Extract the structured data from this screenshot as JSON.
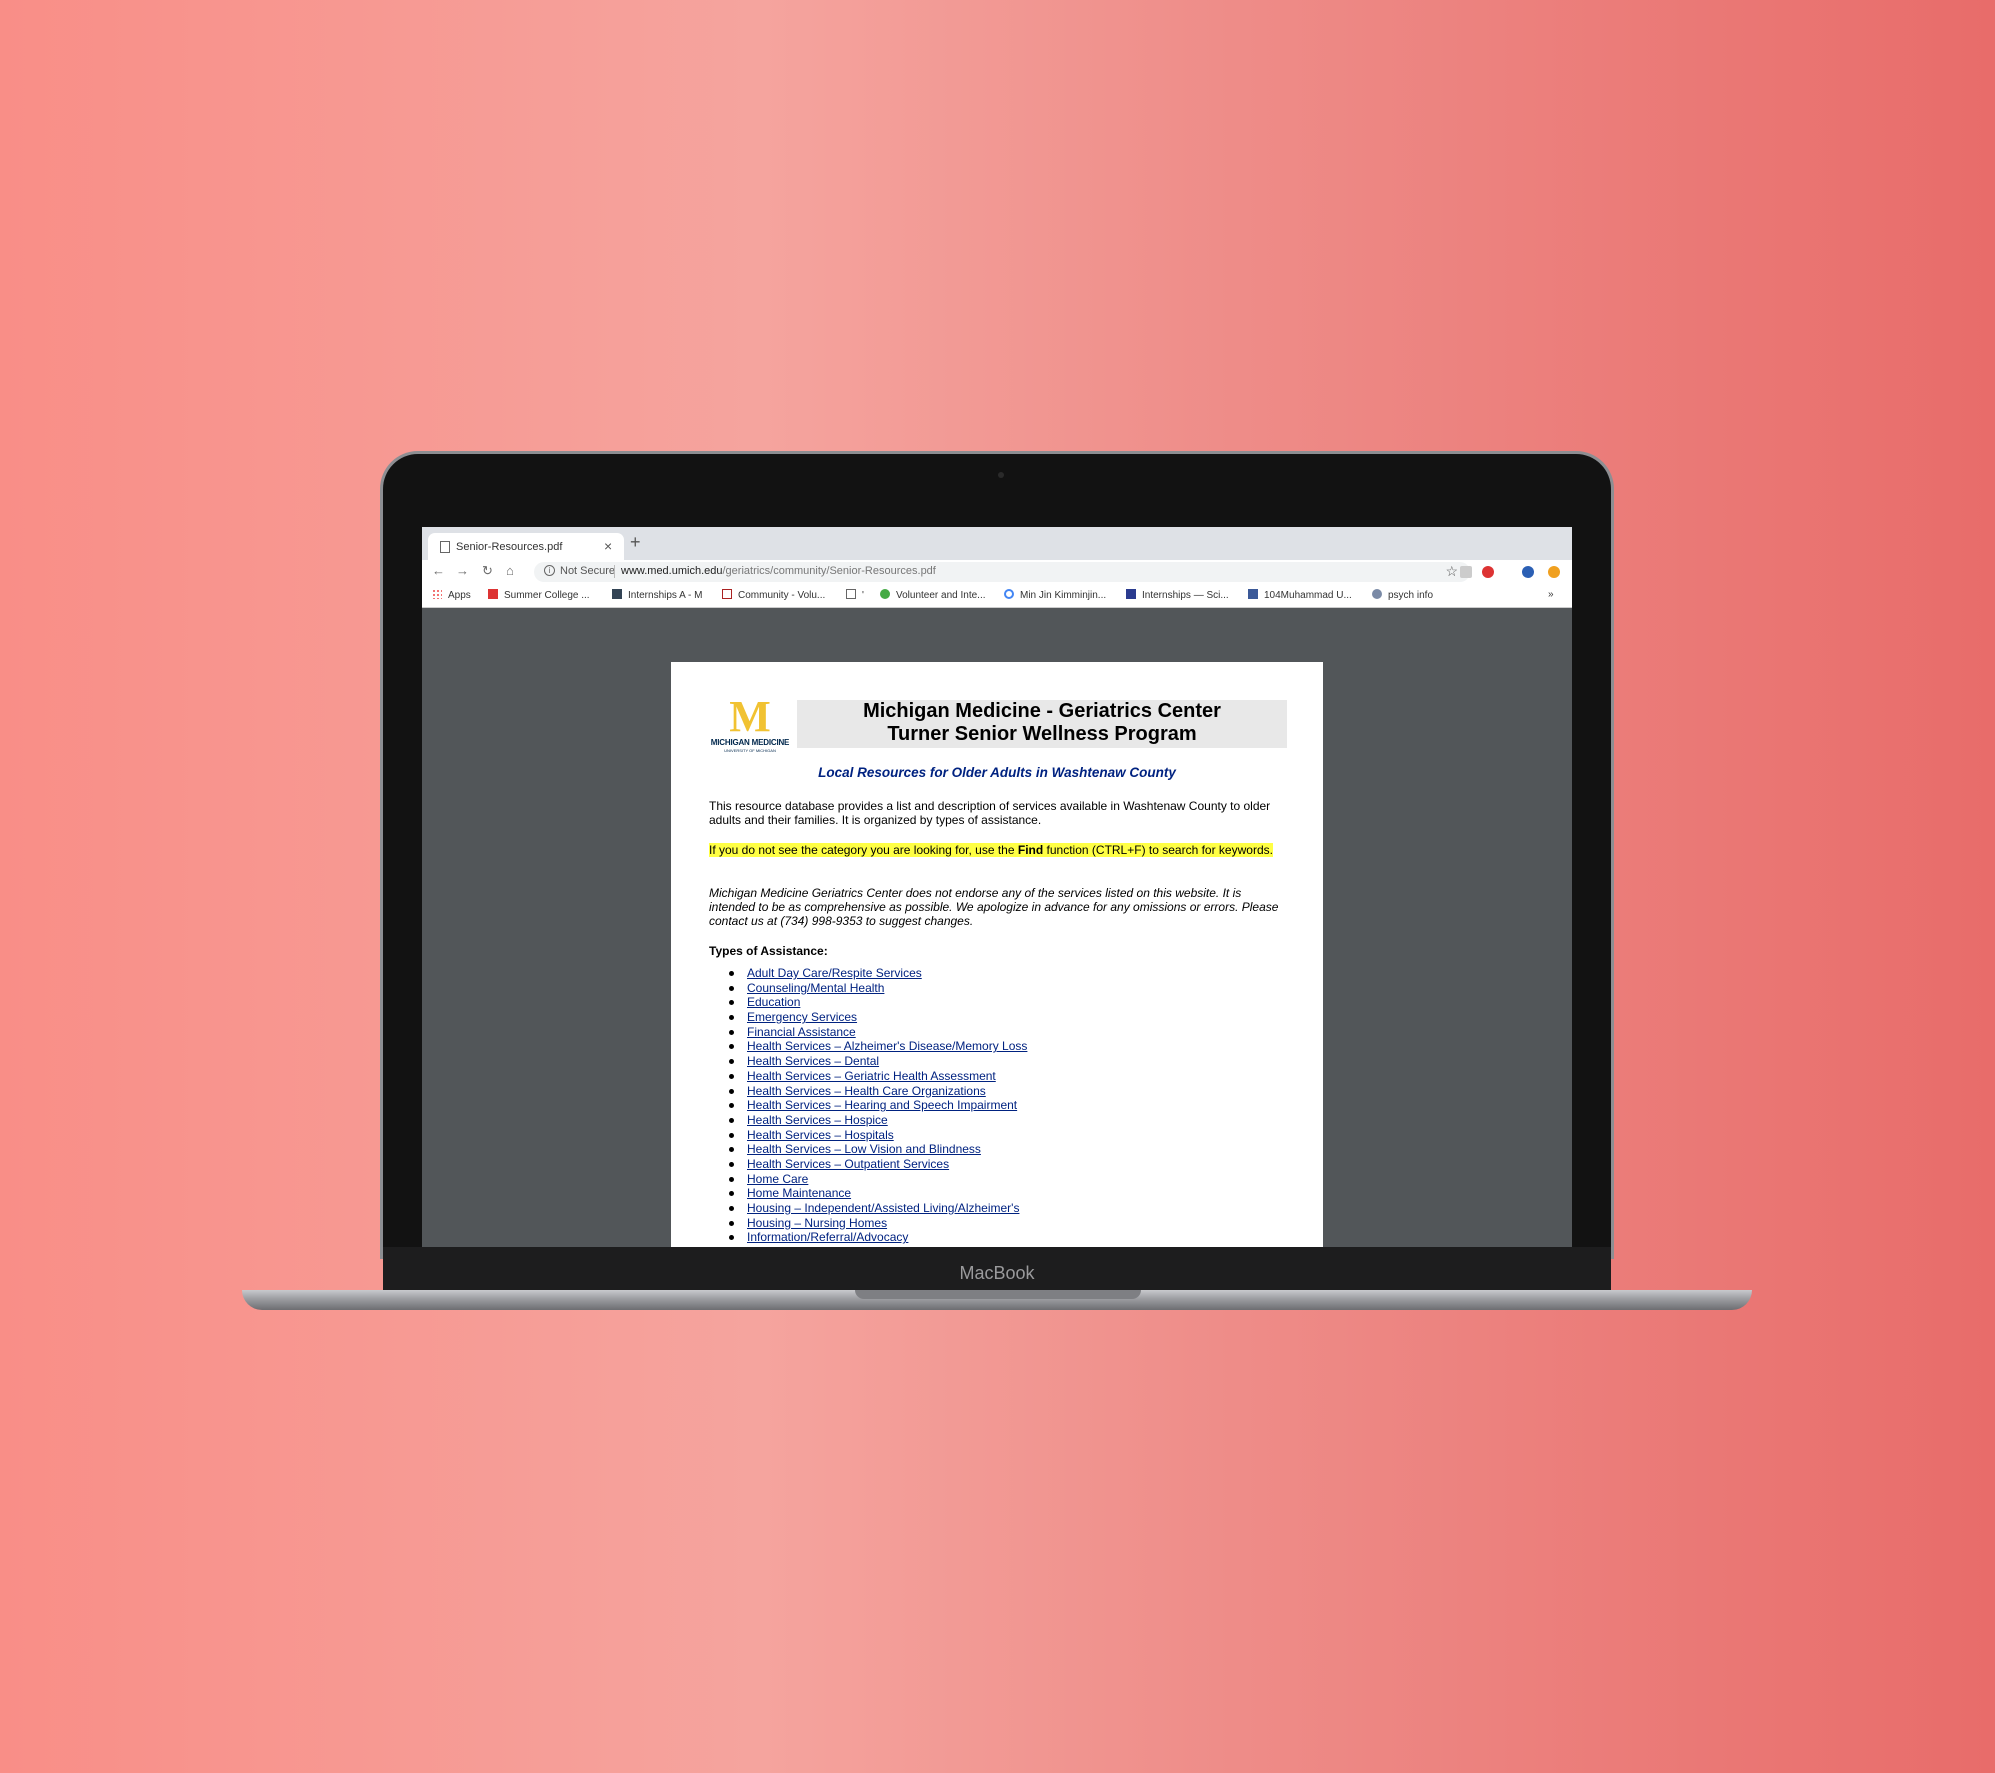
{
  "device": {
    "brand_label": "MacBook"
  },
  "browser": {
    "tab_title": "Senior-Resources.pdf",
    "new_tab": "+",
    "security_label": "Not Secure",
    "url_host": "www.med.umich.edu",
    "url_path": "/geriatrics/community/Senior-Resources.pdf",
    "bookmarks": [
      {
        "label": "Apps"
      },
      {
        "label": "Summer College ..."
      },
      {
        "label": "Internships A - M"
      },
      {
        "label": "Community - Volu..."
      },
      {
        "label": "'"
      },
      {
        "label": "Volunteer and Inte..."
      },
      {
        "label": "Min Jin Kimminjin..."
      },
      {
        "label": "Internships — Sci..."
      },
      {
        "label": "104Muhammad U..."
      },
      {
        "label": "psych info"
      }
    ],
    "more_bookmarks": "»"
  },
  "document": {
    "logo_text": "MICHIGAN MEDICINE",
    "logo_subtext": "UNIVERSITY OF MICHIGAN",
    "header_line1": "Michigan Medicine - Geriatrics Center",
    "header_line2": "Turner Senior Wellness Program",
    "subtitle": "Local Resources for Older Adults in Washtenaw County",
    "intro": "This resource database provides a list and description of services available in Washtenaw County to older adults and their families. It is organized by types of assistance.",
    "find_before": "If you do not see the category you are looking for, use the ",
    "find_bold": "Find",
    "find_after": " function (CTRL+F) to search for keywords.",
    "disclaimer": "Michigan Medicine Geriatrics Center does not endorse any of the services listed on this website. It is intended to be as comprehensive as possible.  We apologize in advance for any omissions or errors. Please contact us at (734) 998-9353 to suggest changes.",
    "types_heading": "Types of Assistance:",
    "types": [
      "Adult Day Care/Respite Services",
      "Counseling/Mental Health",
      "Education",
      "Emergency Services",
      "Financial Assistance",
      "Health Services – Alzheimer's Disease/Memory Loss",
      "Health Services – Dental",
      "Health Services – Geriatric Health Assessment",
      "Health Services – Health Care Organizations",
      "Health Services – Hearing and Speech Impairment",
      "Health Services – Hospice",
      "Health Services – Hospitals",
      "Health Services – Low Vision and Blindness",
      "Health Services – Outpatient Services",
      "Home Care",
      "Home Maintenance",
      "Housing – Independent/Assisted Living/Alzheimer's",
      "Housing – Nursing Homes",
      "Information/Referral/Advocacy"
    ]
  }
}
